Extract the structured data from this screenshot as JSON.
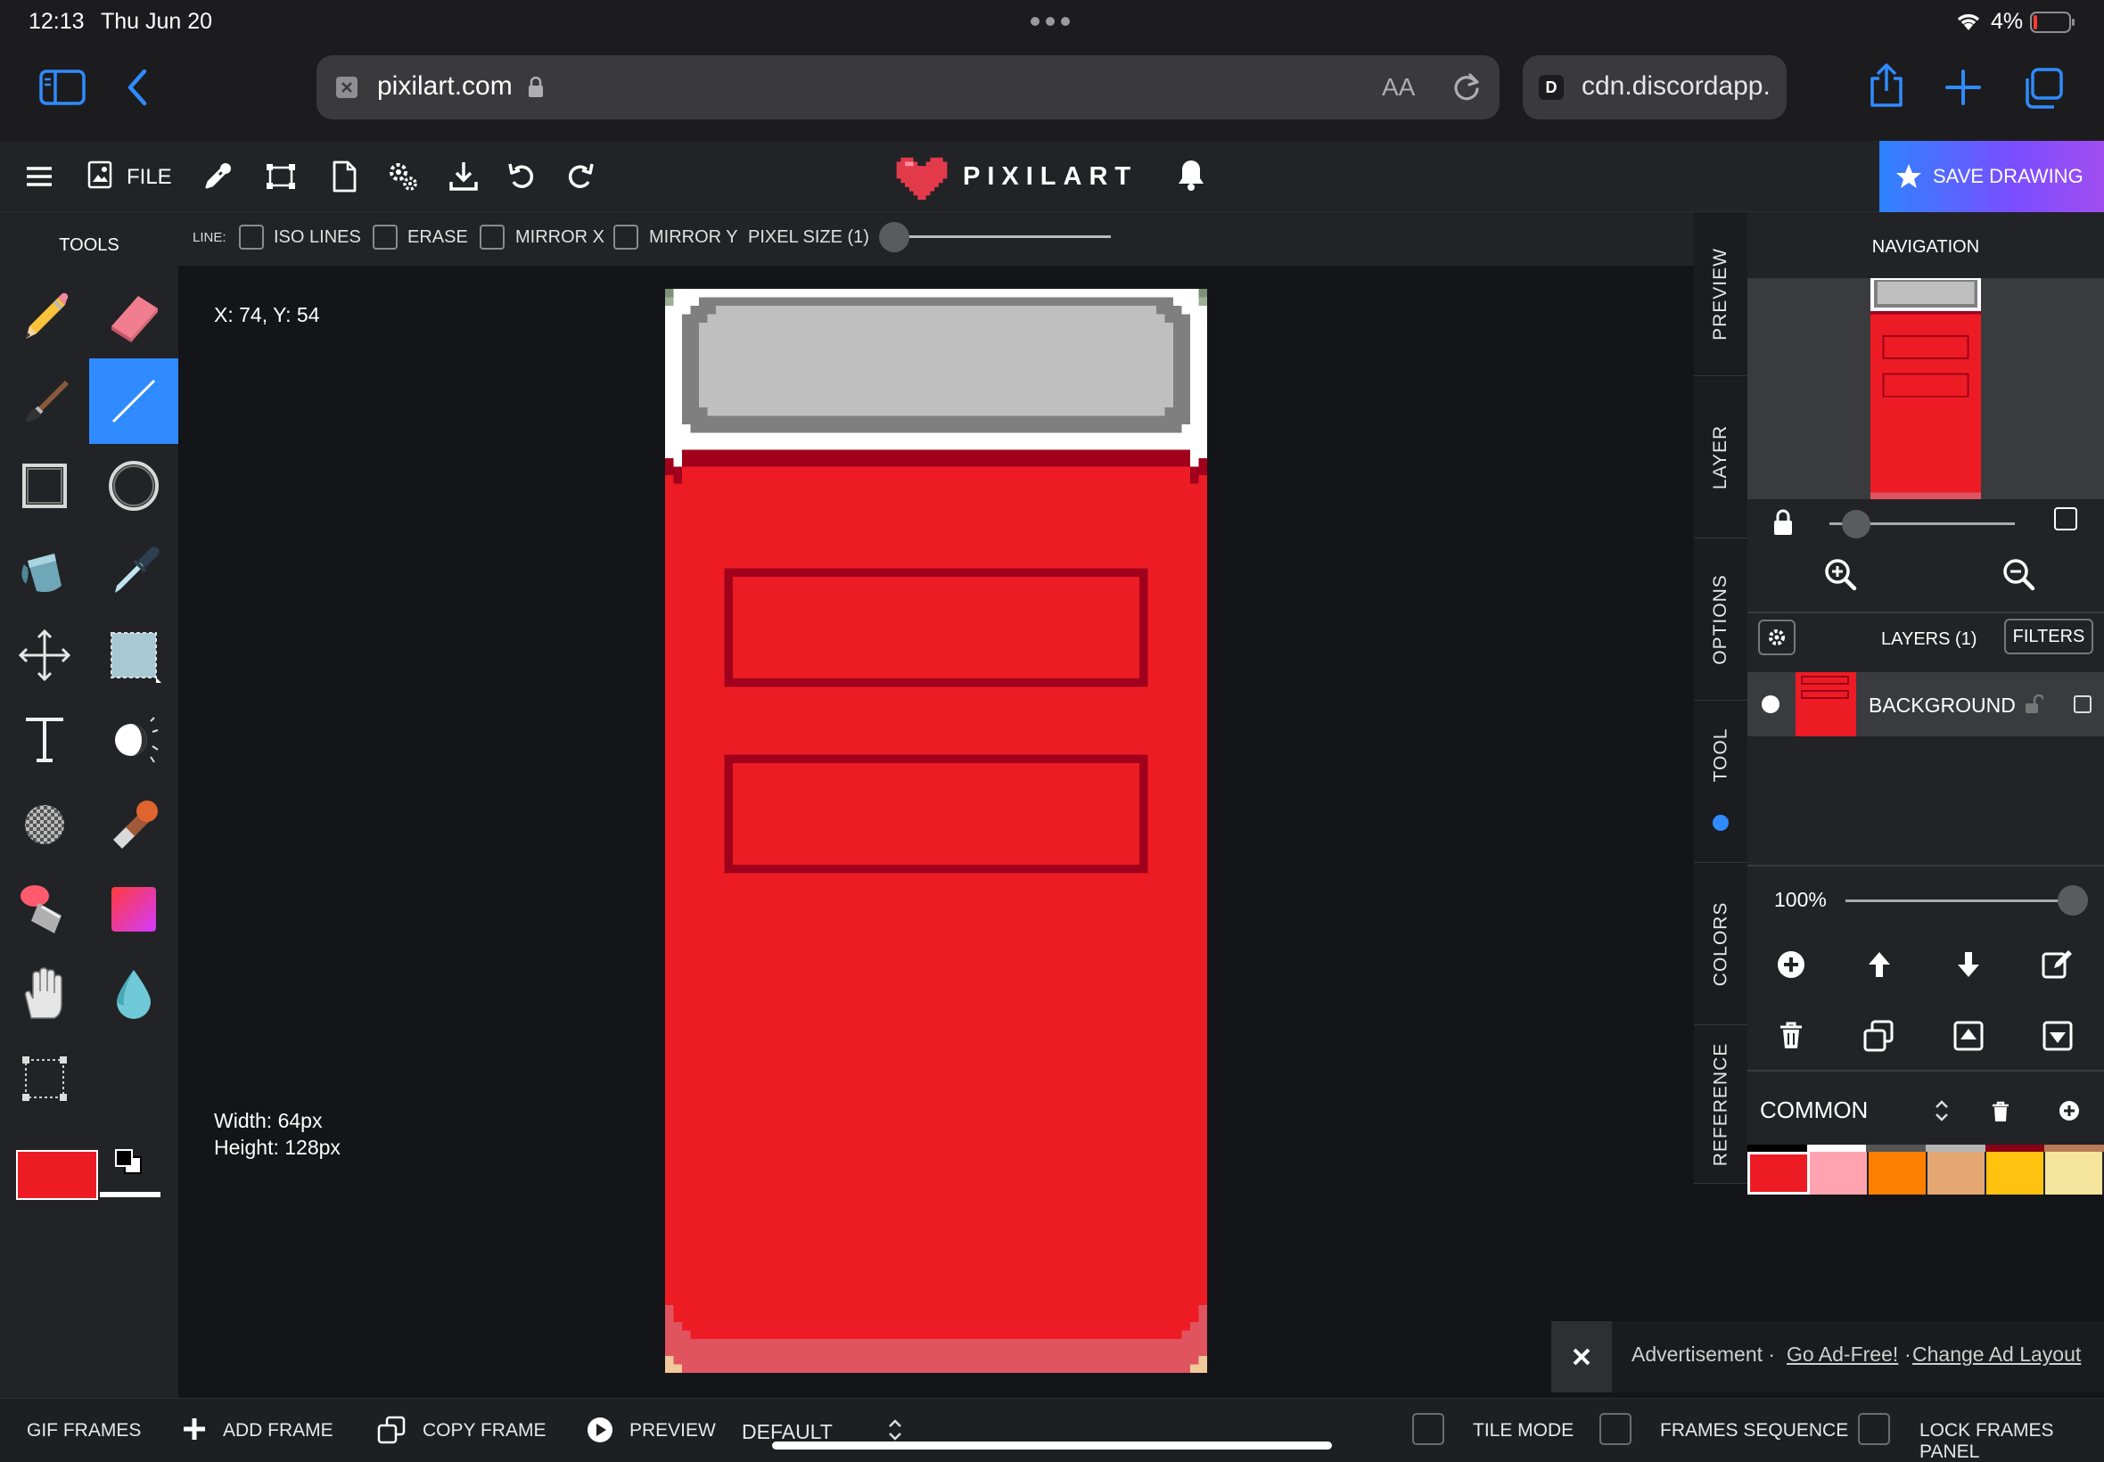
{
  "status_bar": {
    "time": "12:13",
    "date": "Thu Jun 20",
    "battery": "4%"
  },
  "browser": {
    "url": "pixilart.com",
    "aa_label": "AA",
    "second_tab": "cdn.discordapp.",
    "second_tab_badge": "D"
  },
  "app_toolbar": {
    "file_label": "FILE",
    "logo_text": "PIXILART",
    "save_label": "SAVE DRAWING",
    "save_color": "#6a5cff"
  },
  "tools": {
    "header": "TOOLS",
    "items": [
      "pencil",
      "eraser",
      "brush",
      "line",
      "rectangle",
      "circle",
      "bucket",
      "eyedropper",
      "move",
      "select",
      "text",
      "dither",
      "noise",
      "stamp",
      "spray",
      "gradient",
      "hand",
      "drop",
      "crop"
    ],
    "active": "line",
    "primary_color": "#ed1c24",
    "secondary_color": "#ffffff"
  },
  "line_options": {
    "title": "LINE:",
    "iso_lines": "ISO LINES",
    "erase": "ERASE",
    "mirror_x": "MIRROR X",
    "mirror_y": "MIRROR Y",
    "pixel_size": "PIXEL SIZE (1)"
  },
  "canvas": {
    "coords": "X: 74, Y: 54",
    "width_label": "Width: 64px",
    "height_label": "Height: 128px"
  },
  "side_tabs": [
    "PREVIEW",
    "LAYER",
    "OPTIONS",
    "TOOL",
    "COLORS",
    "REFERENCE"
  ],
  "navigation": {
    "title": "NAVIGATION"
  },
  "layers": {
    "title": "LAYERS (1)",
    "filters_label": "FILTERS",
    "items": [
      {
        "name": "BACKGROUND"
      }
    ],
    "opacity": "100%"
  },
  "palette": {
    "name": "COMMON",
    "swatches": [
      "#ed1c24",
      "#ffa3b1",
      "#ff7f00",
      "#e4a672",
      "#ffc20e",
      "#f5e49c"
    ],
    "top_strip": [
      "#000000",
      "#ffffff",
      "#555555",
      "#b4b4b4",
      "#880015",
      "#b97a56"
    ]
  },
  "ad": {
    "text": "Advertisement ·",
    "go_ad_free": "Go Ad-Free!",
    "separator": "·",
    "change_layout": "Change Ad Layout"
  },
  "bottom_bar": {
    "gif_frames": "GIF FRAMES",
    "add_frame": "ADD FRAME",
    "copy_frame": "COPY FRAME",
    "preview": "PREVIEW",
    "default": "DEFAULT",
    "tile_mode": "TILE MODE",
    "frames_sequence": "FRAMES SEQUENCE",
    "lock_frames_panel": "LOCK FRAMES PANEL"
  }
}
